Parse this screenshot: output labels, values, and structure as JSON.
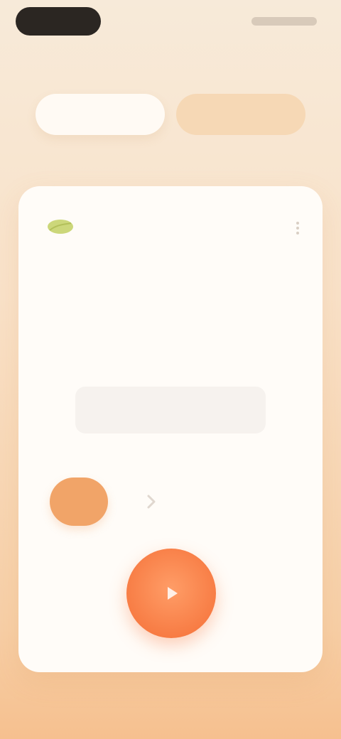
{
  "tabs": [
    {
      "label": "",
      "active": true
    },
    {
      "label": "",
      "active": false
    }
  ],
  "card": {
    "leaf_icon": "leaf-icon",
    "more_icon": "more-icon",
    "mode_title": "",
    "timer_value": "",
    "info_text": ""
  },
  "colors": {
    "accent": "#f77a42",
    "title": "#d9785a",
    "secondary_button": "#f1a468",
    "leaf": "#c7d36b"
  }
}
